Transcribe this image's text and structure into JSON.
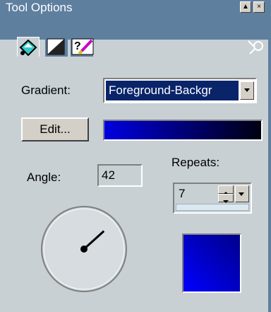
{
  "window": {
    "title": "Tool Options",
    "min_glyph": "▲",
    "close_glyph": "×"
  },
  "tabs": [
    {
      "icon": "paint-bucket-icon"
    },
    {
      "icon": "fg-bg-swatch-icon"
    },
    {
      "icon": "brush-help-icon"
    }
  ],
  "pin_icon": "pin-icon",
  "gradient": {
    "label": "Gradient:",
    "value": "Foreground-Backgr",
    "colors": [
      "#0000e0",
      "#000010"
    ]
  },
  "edit_button": {
    "label": "Edit..."
  },
  "angle": {
    "label": "Angle:",
    "value": "42"
  },
  "repeats": {
    "label": "Repeats:",
    "value": "7"
  },
  "preview": {
    "colors": [
      "#00008a",
      "#0000ff"
    ]
  }
}
